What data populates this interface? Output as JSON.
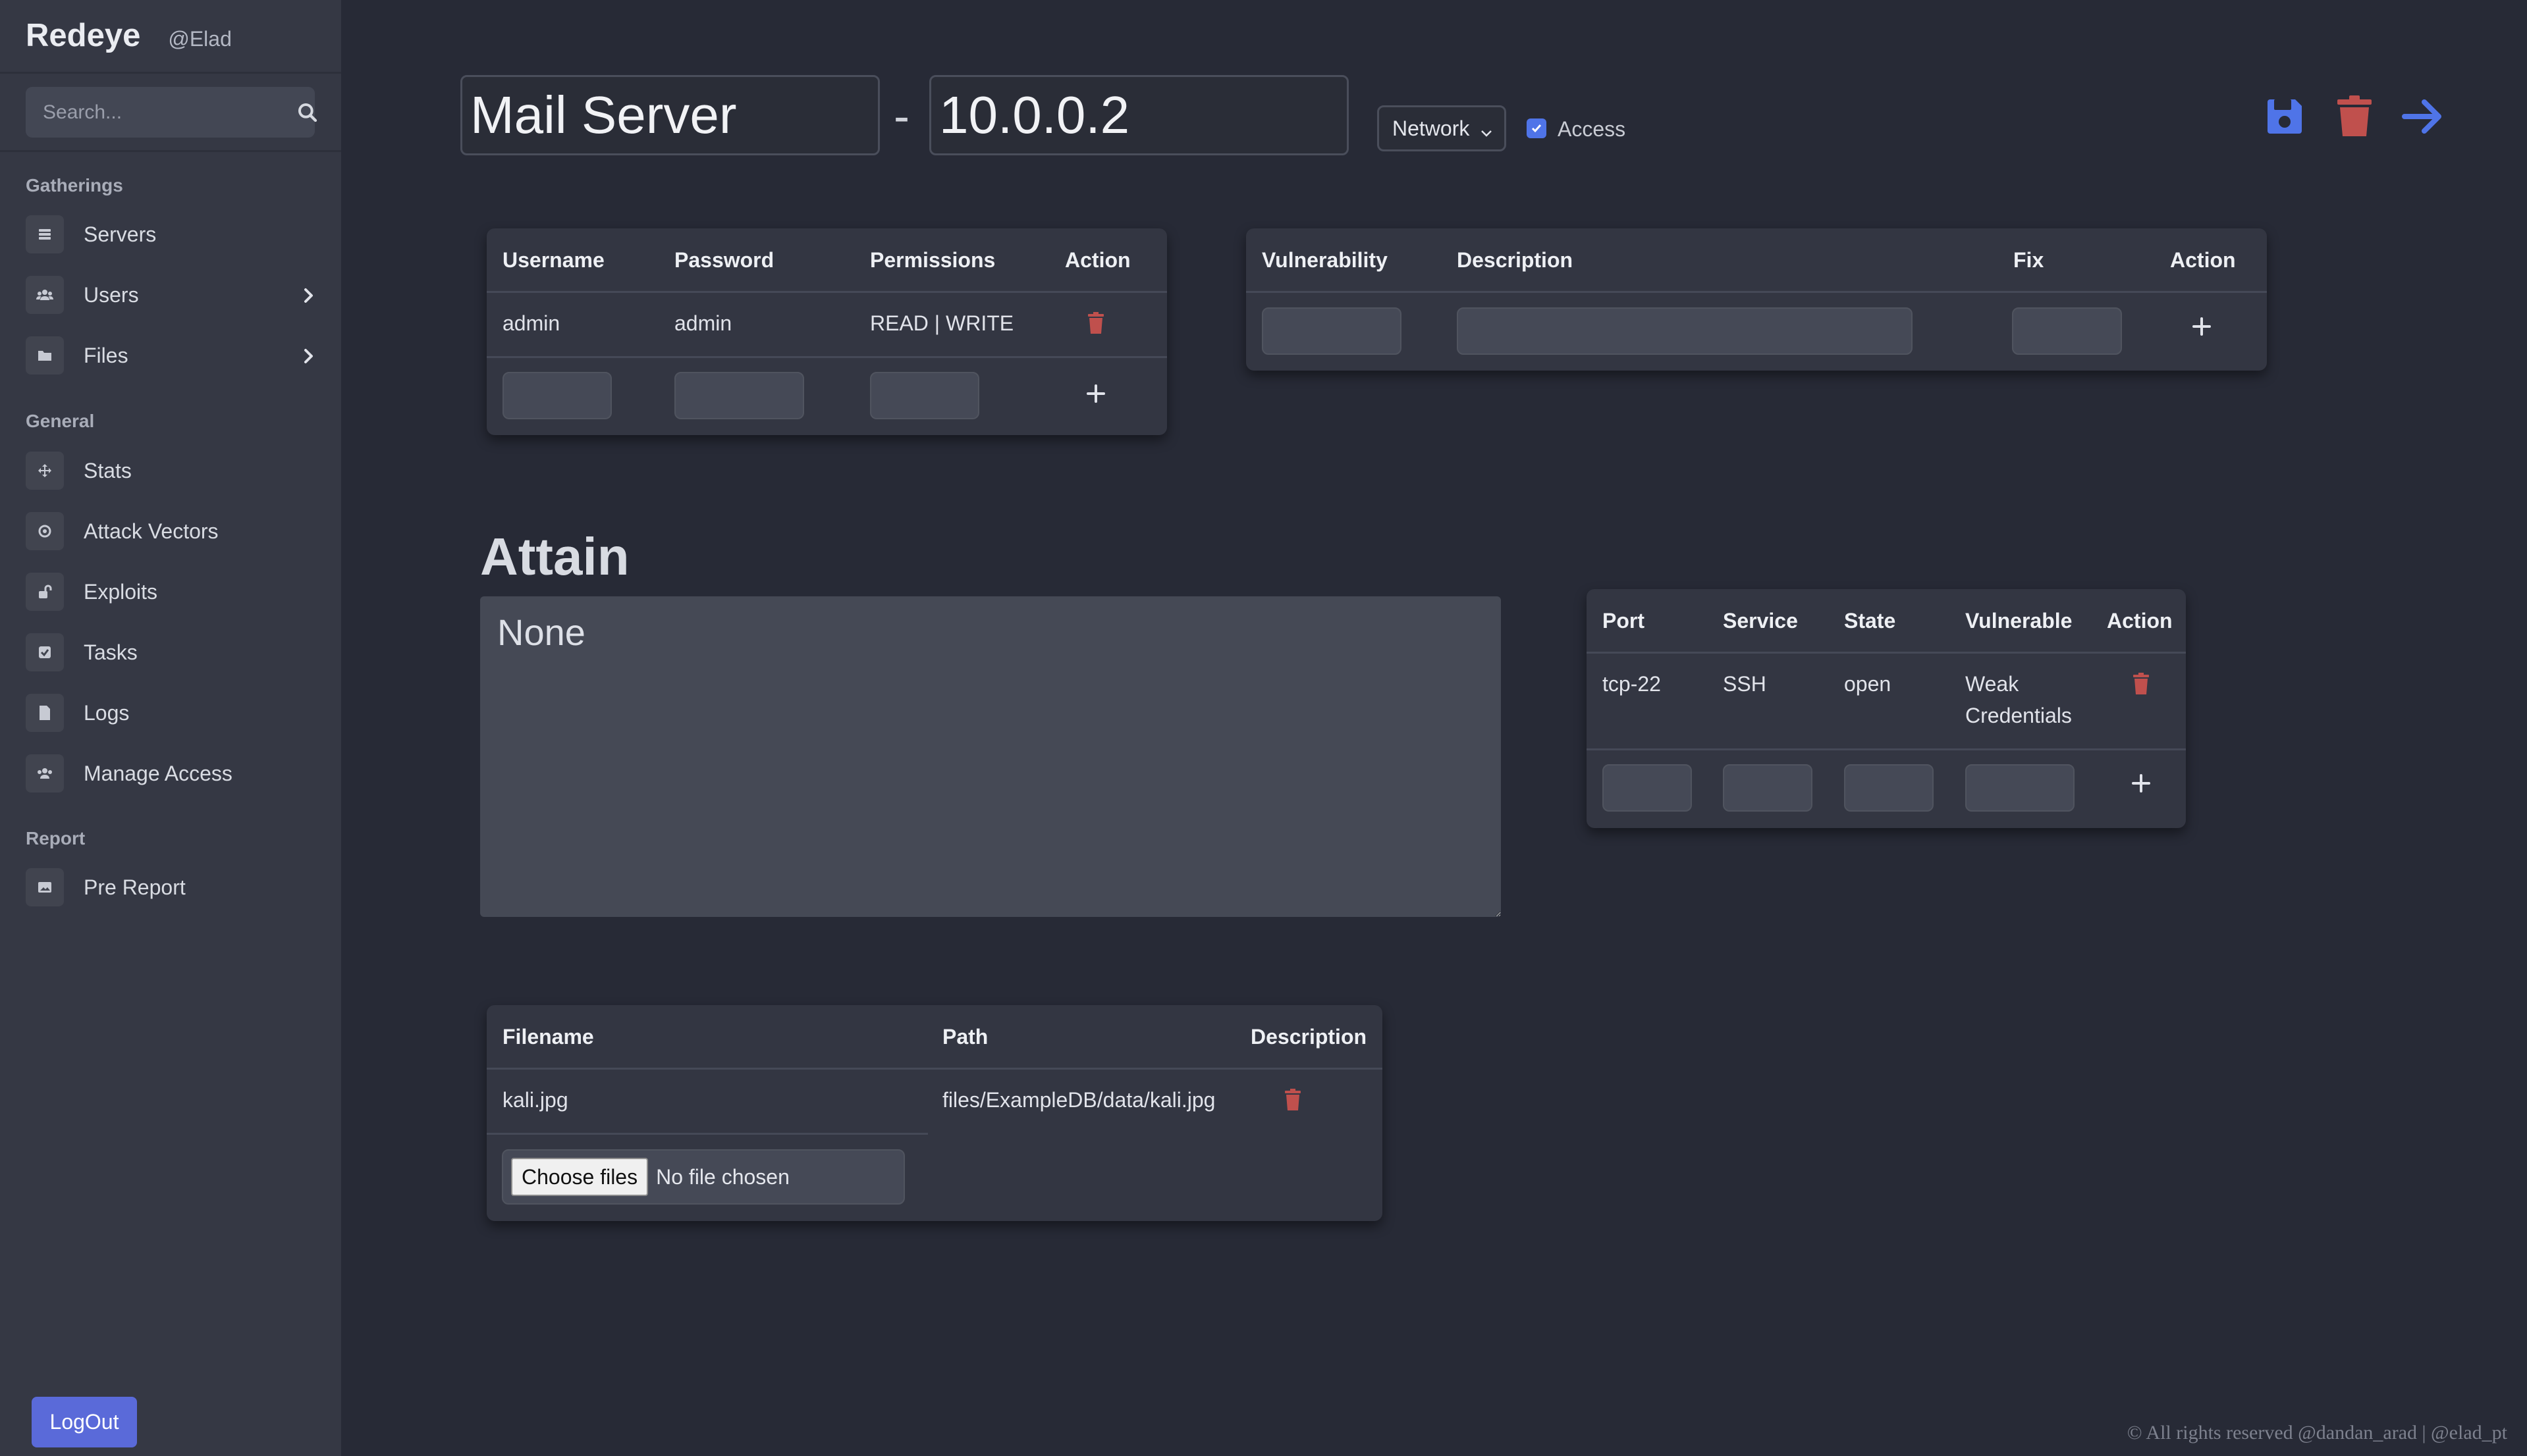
{
  "app": {
    "name": "Redeye",
    "user": "@Elad"
  },
  "search": {
    "placeholder": "Search..."
  },
  "sidebar": {
    "sections": [
      {
        "label": "Gatherings",
        "items": [
          {
            "label": "Servers",
            "icon": "servers-icon"
          },
          {
            "label": "Users",
            "icon": "users-icon",
            "expandable": true
          },
          {
            "label": "Files",
            "icon": "folder-icon",
            "expandable": true
          }
        ]
      },
      {
        "label": "General",
        "items": [
          {
            "label": "Stats",
            "icon": "stats-icon"
          },
          {
            "label": "Attack Vectors",
            "icon": "target-icon"
          },
          {
            "label": "Exploits",
            "icon": "unlock-icon"
          },
          {
            "label": "Tasks",
            "icon": "check-square-icon"
          },
          {
            "label": "Logs",
            "icon": "file-icon"
          },
          {
            "label": "Manage Access",
            "icon": "users-icon"
          }
        ]
      },
      {
        "label": "Report",
        "items": [
          {
            "label": "Pre Report",
            "icon": "image-icon"
          }
        ]
      }
    ],
    "logout_label": "LogOut"
  },
  "header": {
    "name_value": "Mail Server",
    "separator": "-",
    "ip_value": "10.0.0.2",
    "type_select": "Network",
    "access_label": "Access",
    "access_checked": true
  },
  "users_table": {
    "columns": [
      "Username",
      "Password",
      "Permissions",
      "Action"
    ],
    "rows": [
      {
        "username": "admin",
        "password": "admin",
        "permissions": "READ | WRITE"
      }
    ]
  },
  "vuln_table": {
    "columns": [
      "Vulnerability",
      "Description",
      "Fix",
      "Action"
    ]
  },
  "attain": {
    "title": "Attain",
    "value": "None"
  },
  "ports_table": {
    "columns": [
      "Port",
      "Service",
      "State",
      "Vulnerable",
      "Action"
    ],
    "rows": [
      {
        "port": "tcp-22",
        "service": "SSH",
        "state": "open",
        "vulnerable": "Weak Credentials"
      }
    ]
  },
  "files_table": {
    "columns": [
      "Filename",
      "Path",
      "Description"
    ],
    "rows": [
      {
        "filename": "kali.jpg",
        "path": "files/ExampleDB/data/kali.jpg"
      }
    ],
    "choose_label": "Choose files",
    "no_file_label": "No file chosen"
  },
  "footer": {
    "text": "© All rights reserved @dandan_arad | @elad_pt"
  },
  "colors": {
    "background": "#272a36",
    "sidebar": "#353844",
    "card": "#333642",
    "accent_blue": "#4f74e8",
    "danger_red": "#c0504d",
    "logout_button": "#5a6ad9"
  }
}
